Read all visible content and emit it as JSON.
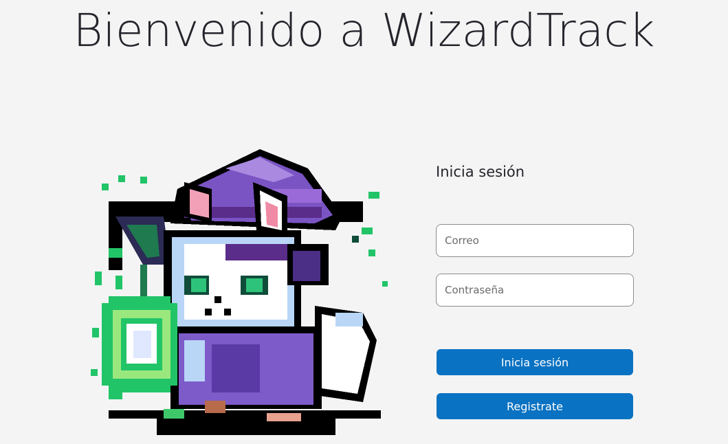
{
  "header": {
    "title": "Bienvenido a WizardTrack"
  },
  "mascot": {
    "icon": "pixel-wizard-cat-icon"
  },
  "login": {
    "heading": "Inicia sesión",
    "email_placeholder": "Correo",
    "password_placeholder": "Contraseña",
    "login_button": "Inicia sesión",
    "register_button": "Registrate"
  },
  "colors": {
    "background": "#f4f4f4",
    "accent": "#0a72c2",
    "text": "#24242c"
  }
}
